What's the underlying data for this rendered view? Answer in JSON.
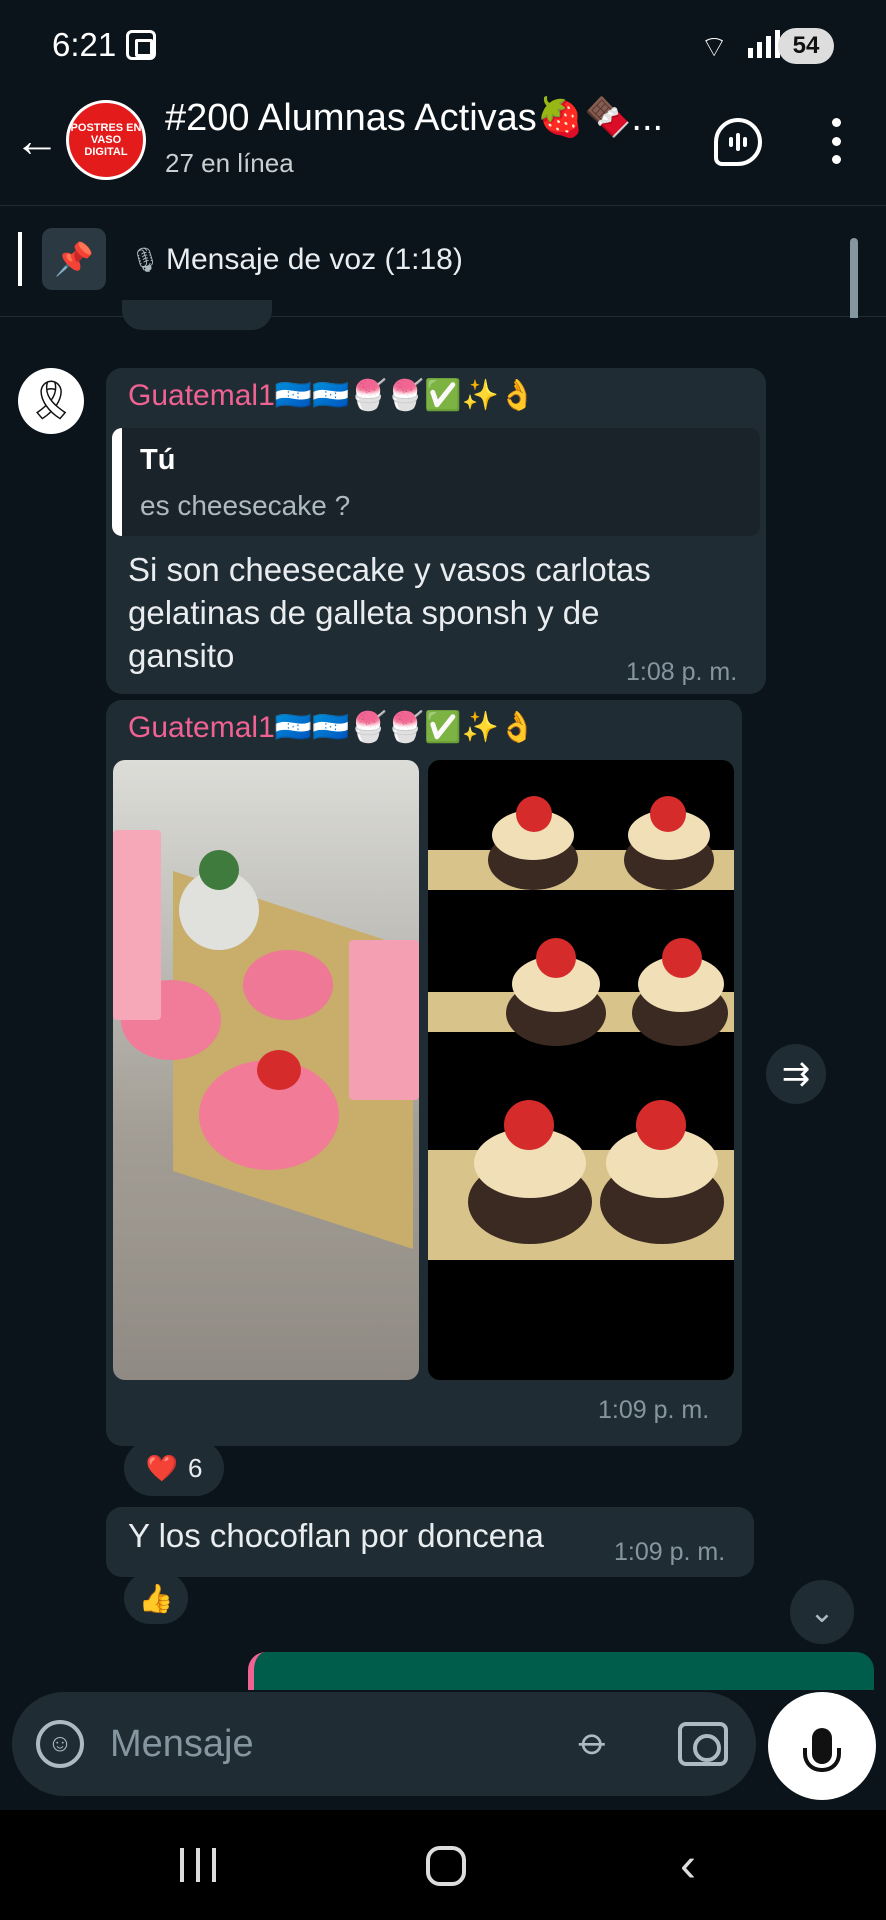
{
  "status_bar": {
    "time": "6:21",
    "battery": "54",
    "wifi_icon": "wifi-icon",
    "signal_icon": "signal-icon"
  },
  "header": {
    "avatar_text": "POSTRES EN VASO DIGITAL",
    "title": "#200 Alumnas Activas🍓🍫...",
    "subtitle": "27 en línea"
  },
  "pinned": {
    "text": "Mensaje de voz (1:18)"
  },
  "messages": [
    {
      "sender": "Guatemal1🇭🇳🇭🇳🍧🍧✅✨👌",
      "quote_author": "Tú",
      "quote_text": "es cheesecake ?",
      "lines": [
        "Si son cheesecake y vasos carlotas",
        "gelatinas de galleta sponsh y de",
        "gansito"
      ],
      "time": "1:08 p. m."
    },
    {
      "sender": "Guatemal1🇭🇳🇭🇳🍧🍧✅✨👌",
      "time": "1:09 p. m.",
      "reaction": {
        "emoji": "❤️",
        "count": "6"
      }
    },
    {
      "text": "Y los chocoflan por doncena",
      "time": "1:09 p. m.",
      "reaction": {
        "emoji": "👍"
      }
    }
  ],
  "input": {
    "placeholder": "Mensaje"
  },
  "colors": {
    "background": "#0b141a",
    "bubble": "#202c33",
    "sender": "#f06292",
    "outgoing": "#005c4b"
  }
}
